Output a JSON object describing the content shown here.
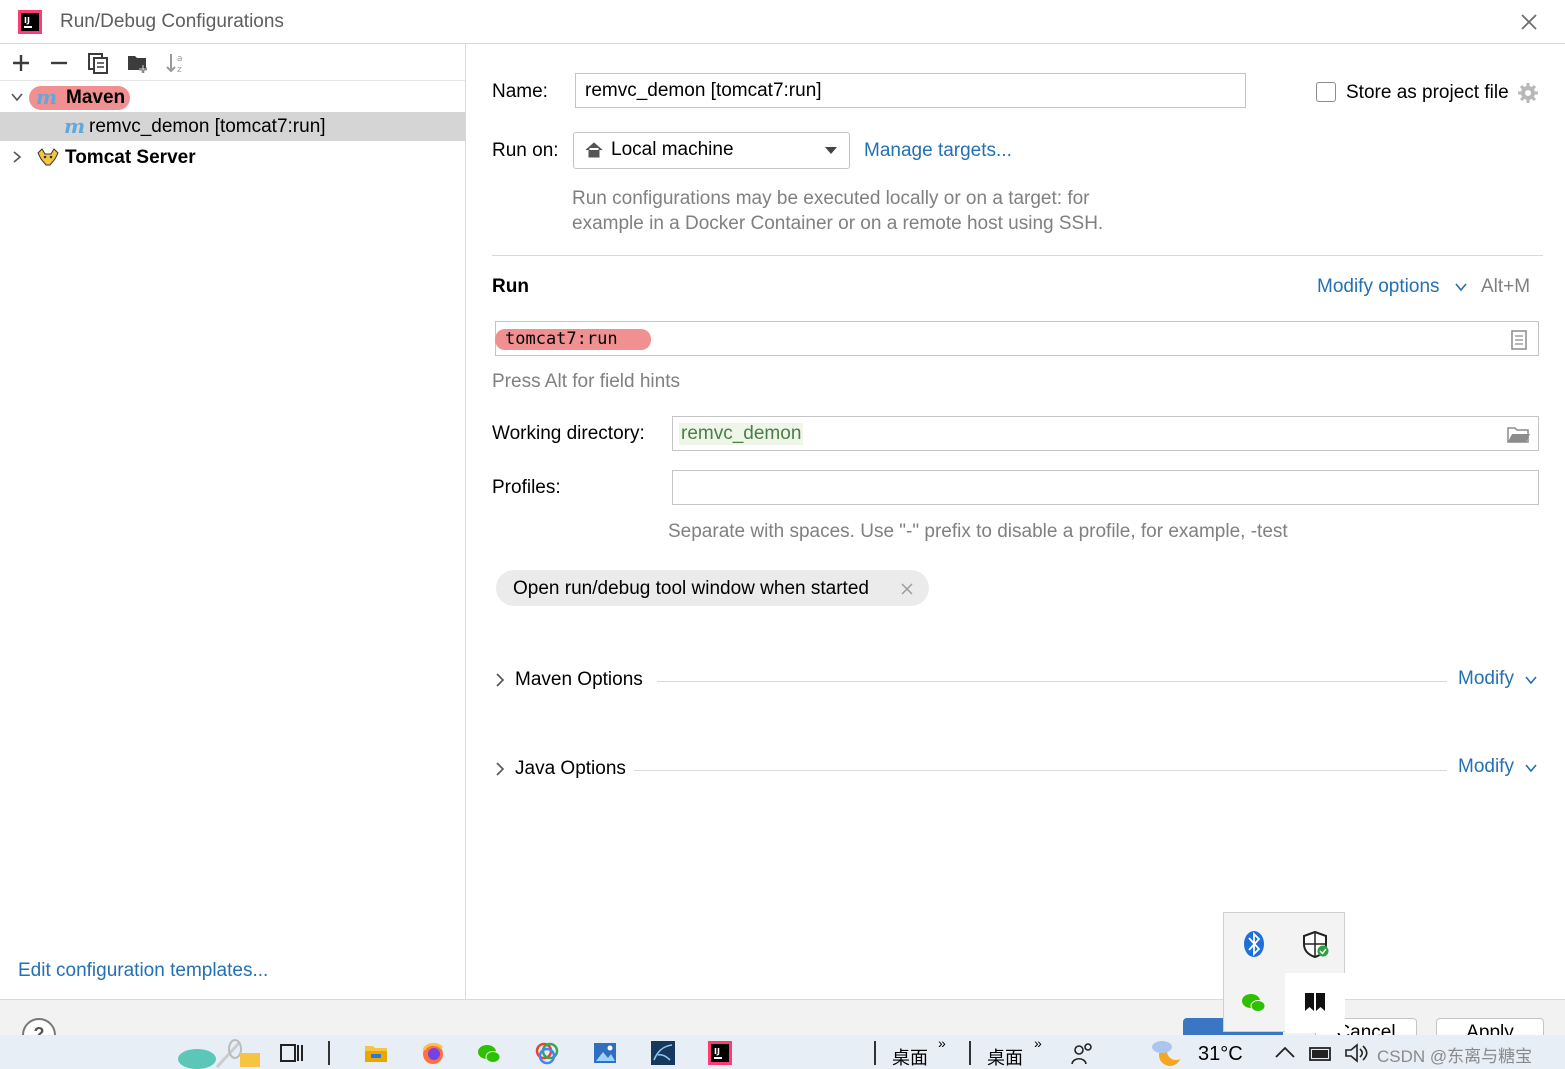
{
  "window": {
    "title": "Run/Debug Configurations"
  },
  "toolbar": {
    "buttons": [
      "add-icon",
      "remove-icon",
      "copy-icon",
      "new-folder-icon",
      "sort-icon"
    ]
  },
  "tree": {
    "groups": [
      {
        "label": "Maven",
        "expanded": true,
        "children": [
          {
            "label": "remvc_demon [tomcat7:run]",
            "selected": true
          }
        ]
      },
      {
        "label": "Tomcat Server",
        "expanded": false
      }
    ]
  },
  "left_footer": {
    "templates_link": "Edit configuration templates..."
  },
  "form": {
    "name_label": "Name:",
    "name_value": "remvc_demon [tomcat7:run]",
    "store_label": "Store as project file",
    "store_checked": false,
    "run_on_label": "Run on:",
    "run_on_value": "Local machine",
    "manage_targets": "Manage targets...",
    "run_on_hint_1": "Run configurations may be executed locally or on a target: for",
    "run_on_hint_2": "example in a Docker Container or on a remote host using SSH.",
    "run_section": "Run",
    "modify_options": "Modify options",
    "modify_shortcut": "Alt+M",
    "command_value": "tomcat7:run",
    "field_hints": "Press Alt for field hints",
    "workdir_label": "Working directory:",
    "workdir_value": "remvc_demon",
    "profiles_label": "Profiles:",
    "profiles_value": "",
    "profiles_hint": "Separate with spaces. Use \"-\" prefix to disable a profile, for example, -test",
    "chip_label": "Open run/debug tool window when started",
    "maven_options": "Maven Options",
    "java_options": "Java Options",
    "modify": "Modify"
  },
  "bottom": {
    "cancel_label": "Cancel",
    "apply_label": "Apply",
    "help_label": "?"
  },
  "taskbar": {
    "desktop_1": "桌面",
    "desktop_2": "桌面",
    "temperature": "31°C",
    "watermark": "CSDN @东离与糖宝"
  },
  "colors": {
    "accent_link": "#2470b3",
    "highlight_red": "#f19090",
    "selection": "#d5d5d5",
    "hint_gray": "#808080",
    "primary_button": "#3b76c4"
  }
}
